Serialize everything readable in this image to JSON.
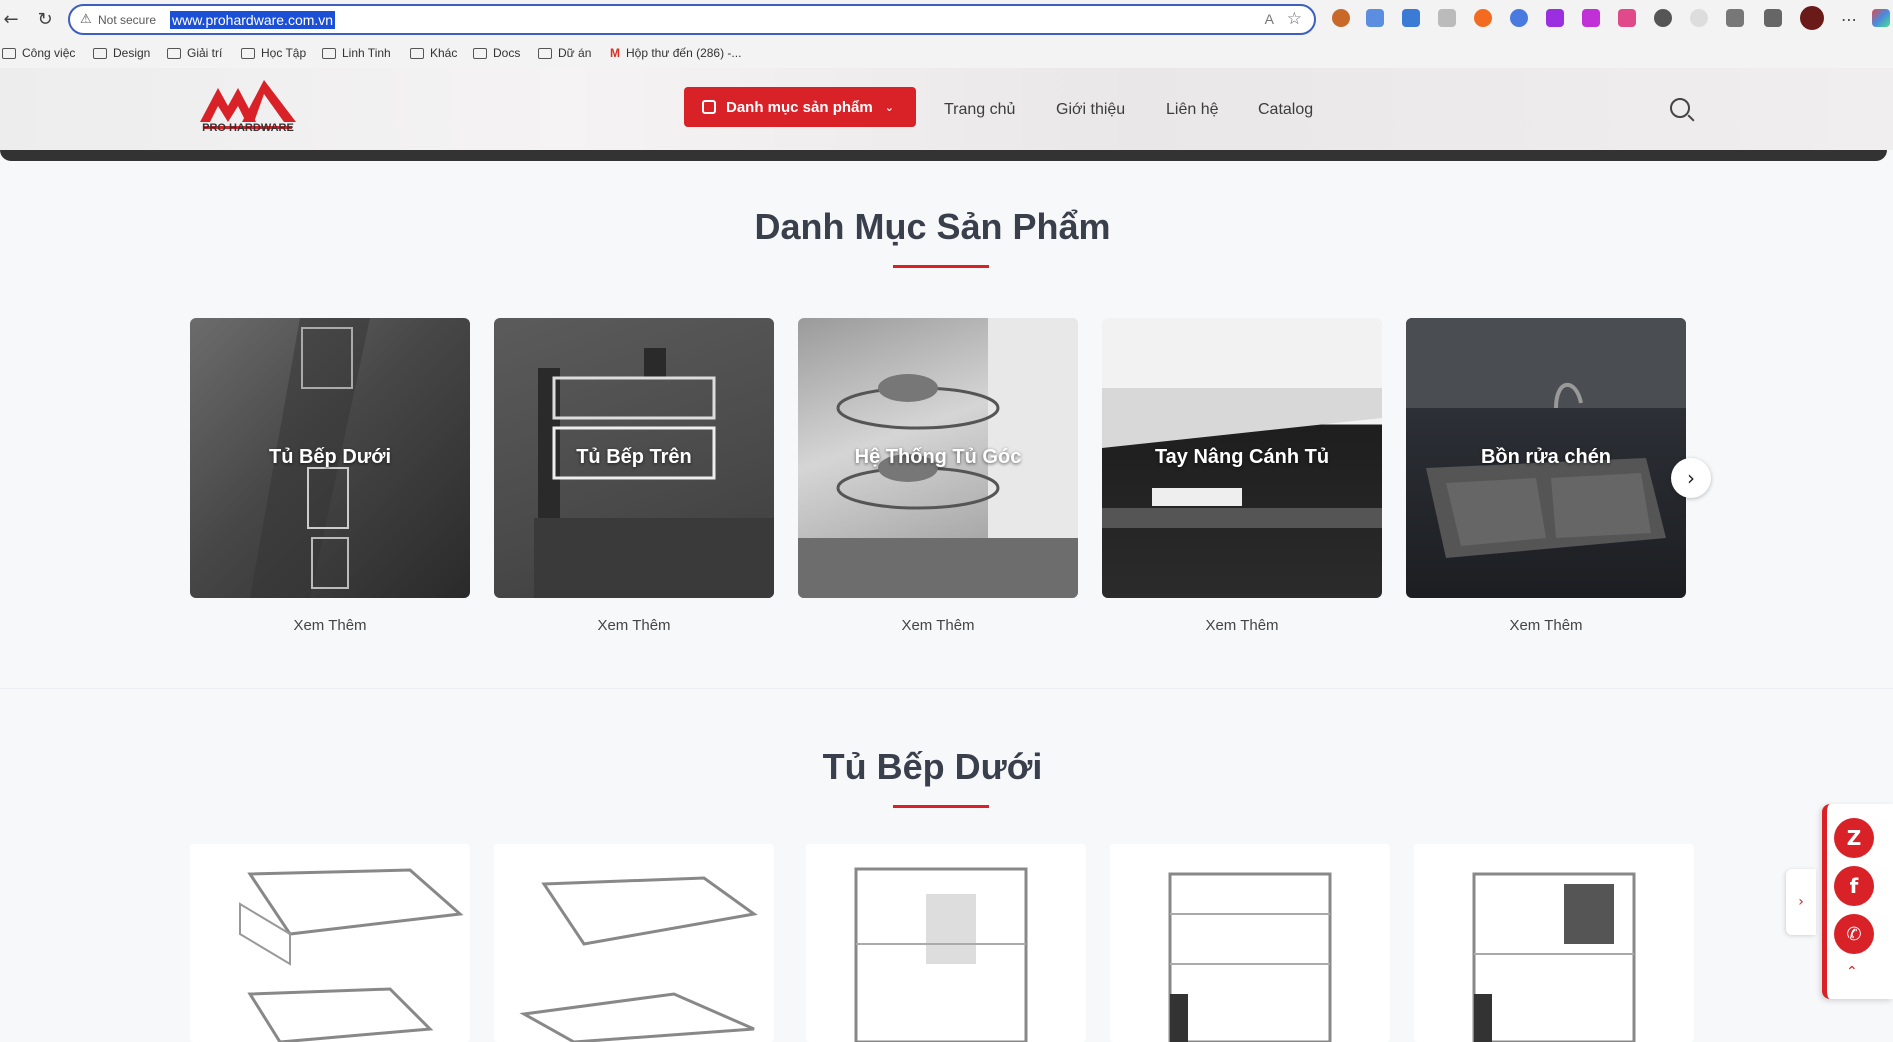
{
  "browser": {
    "not_secure": "Not secure",
    "url": "www.prohardware.com.vn",
    "read_aloud": "A",
    "bookmarks": [
      "Công việc",
      "Design",
      "Giải trí",
      "Học Tập",
      "Linh Tinh",
      "Khác",
      "Docs",
      "Dữ án",
      "Hộp thư đến (286) -..."
    ],
    "gmail_mark": "M"
  },
  "header": {
    "logo_text": "PRO HARDWARE",
    "category_button": "Danh mục sản phẩm",
    "menu": [
      "Trang chủ",
      "Giới thiệu",
      "Liên hệ",
      "Catalog"
    ]
  },
  "categories": {
    "title": "Danh Mục Sản Phẩm",
    "see_more": "Xem Thêm",
    "items": [
      {
        "label": "Tủ Bếp Dưới"
      },
      {
        "label": "Tủ Bếp Trên"
      },
      {
        "label": "Hệ Thống Tủ Góc"
      },
      {
        "label": "Tay Nâng Cánh Tủ"
      },
      {
        "label": "Bồn rửa chén"
      }
    ]
  },
  "section2": {
    "title": "Tủ Bếp Dưới"
  },
  "floating": {
    "zalo": "Z",
    "facebook": "f",
    "phone": "✆"
  },
  "colors": {
    "accent": "#d92128",
    "link_highlight": "#1a4fd6"
  }
}
